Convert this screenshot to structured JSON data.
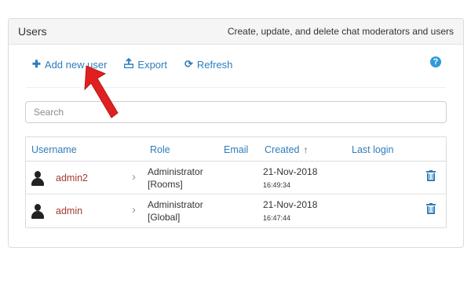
{
  "panel": {
    "title": "Users",
    "subtitle": "Create, update, and delete chat moderators and users"
  },
  "toolbar": {
    "add_label": "Add new user",
    "export_label": "Export",
    "refresh_label": "Refresh",
    "help_symbol": "?",
    "add_icon": "plus-icon",
    "export_icon": "export-icon",
    "refresh_icon": "refresh-icon",
    "help_icon": "question-circle-icon"
  },
  "search": {
    "placeholder": "Search",
    "value": ""
  },
  "table": {
    "columns": {
      "username": "Username",
      "role": "Role",
      "email": "Email",
      "created": "Created",
      "last_login": "Last login"
    },
    "sort_indicator": "↑",
    "rows": [
      {
        "username": "admin2",
        "role_line1": "Administrator",
        "role_line2": "[Rooms]",
        "email": "",
        "created_date": "21-Nov-2018",
        "created_time": "16:49:34",
        "last_login": ""
      },
      {
        "username": "admin",
        "role_line1": "Administrator",
        "role_line2": "[Global]",
        "email": "",
        "created_date": "21-Nov-2018",
        "created_time": "16:47:44",
        "last_login": ""
      }
    ]
  },
  "colors": {
    "link": "#2f7dbb",
    "username": "#a33a2f",
    "annotation_arrow": "#e02020"
  }
}
